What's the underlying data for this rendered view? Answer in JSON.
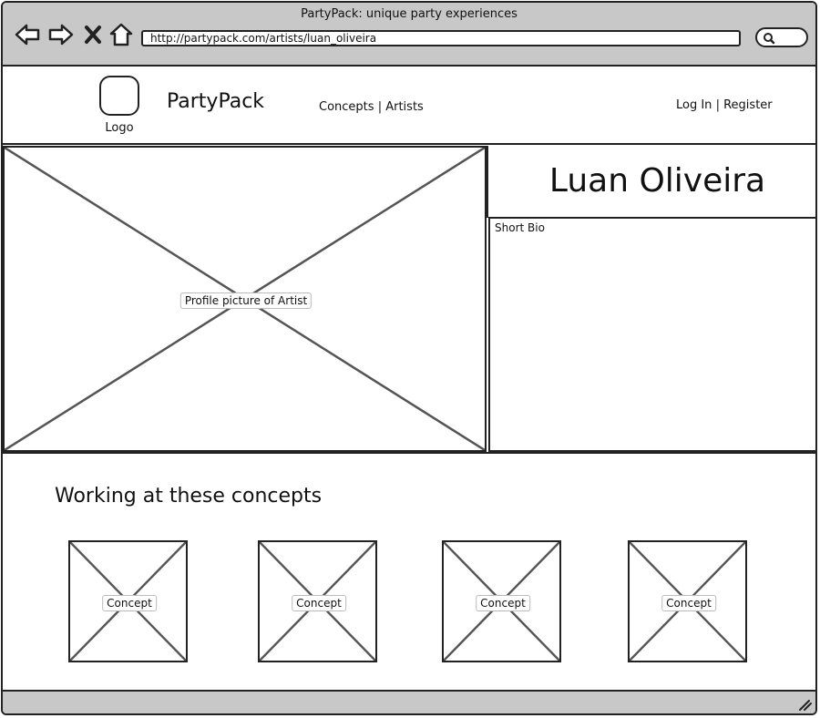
{
  "browser": {
    "window_title": "PartyPack: unique party experiences",
    "url": "http://partypack.com/artists/luan_oliveira",
    "nav_icons": [
      "back-arrow-icon",
      "forward-arrow-icon",
      "close-x-icon",
      "home-icon"
    ],
    "search_icon": "search-icon"
  },
  "header": {
    "logo_label": "Logo",
    "brand": "PartyPack",
    "nav": {
      "concepts": "Concepts",
      "separator": "|",
      "artists": "Artists"
    },
    "auth": {
      "login": "Log In",
      "separator": "|",
      "register": "Register"
    }
  },
  "artist": {
    "name": "Luan Oliveira",
    "picture_label": "Profile picture of Artist",
    "bio_label": "Short Bio"
  },
  "concepts": {
    "title": "Working at these concepts",
    "items": [
      {
        "label": "Concept"
      },
      {
        "label": "Concept"
      },
      {
        "label": "Concept"
      },
      {
        "label": "Concept"
      }
    ]
  }
}
